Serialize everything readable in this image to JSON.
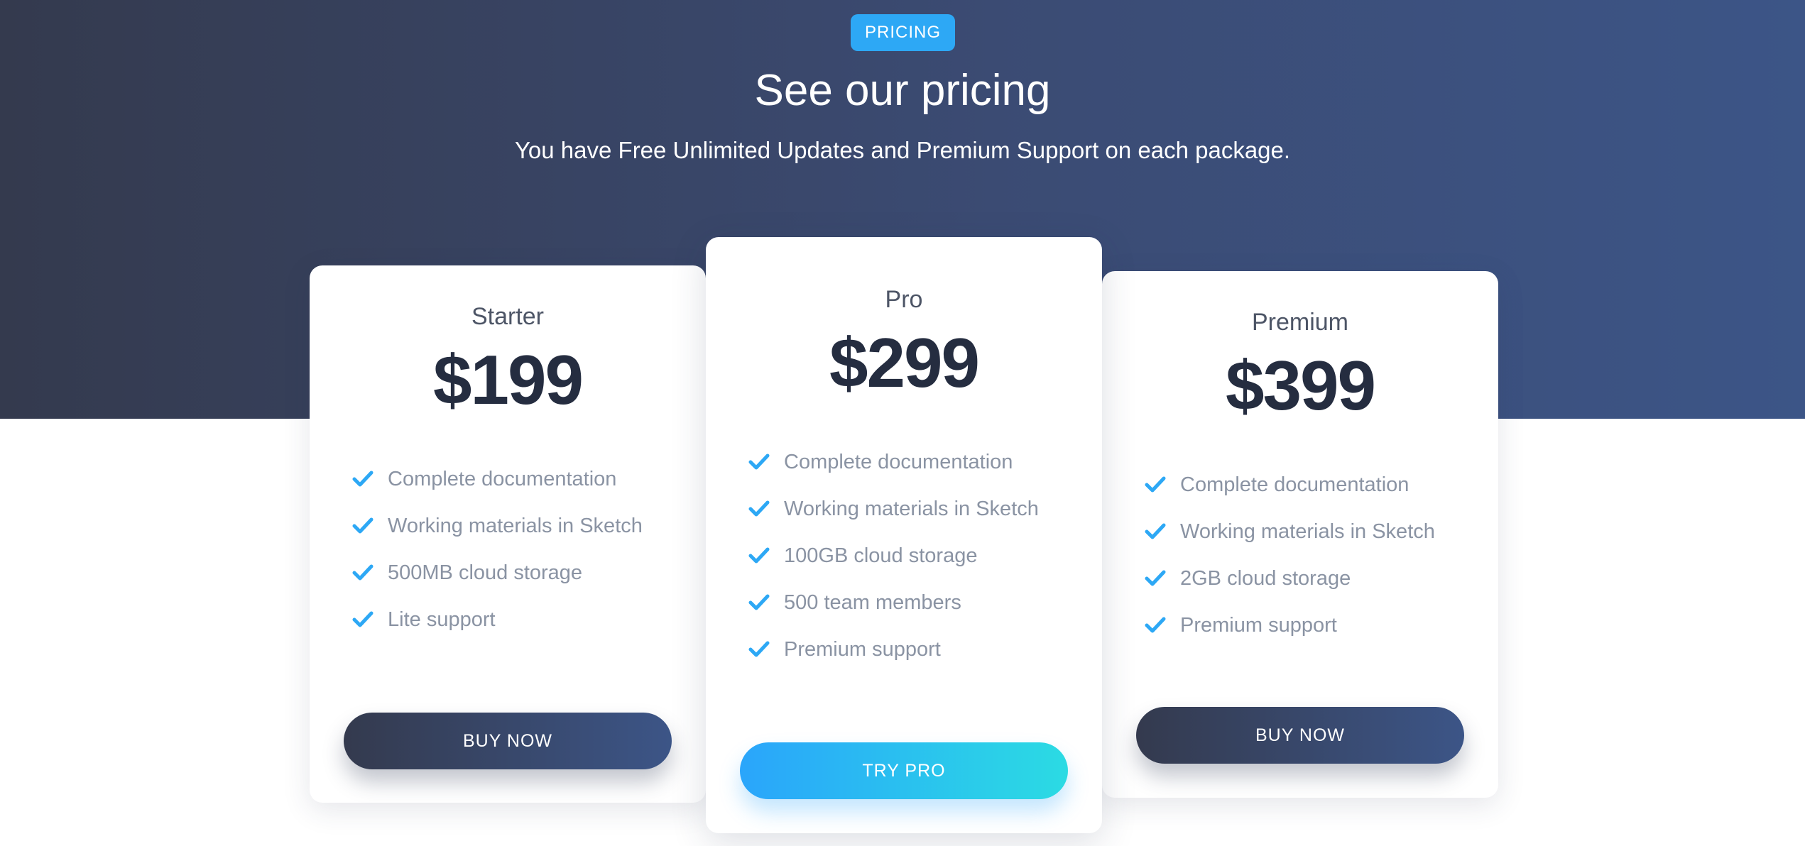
{
  "header": {
    "badge": "PRICING",
    "title": "See our pricing",
    "subtitle": "You have Free Unlimited Updates and Premium Support on each package."
  },
  "plans": [
    {
      "name": "Starter",
      "price": "$199",
      "features": [
        "Complete documentation",
        "Working materials in Sketch",
        "500MB cloud storage",
        "Lite support"
      ],
      "button": "BUY NOW"
    },
    {
      "name": "Pro",
      "price": "$299",
      "features": [
        "Complete documentation",
        "Working materials in Sketch",
        "100GB cloud storage",
        "500 team members",
        "Premium support"
      ],
      "button": "TRY PRO"
    },
    {
      "name": "Premium",
      "price": "$399",
      "features": [
        "Complete documentation",
        "Working materials in Sketch",
        "2GB cloud storage",
        "Premium support"
      ],
      "button": "BUY NOW"
    }
  ],
  "icons": {
    "feature_icon": "check-icon"
  },
  "colors": {
    "hero_start": "#343a4e",
    "hero_end": "#3c5587",
    "accent": "#2da8f5",
    "accent_end": "#2bdbe3",
    "price_text": "#252d40",
    "feature_text": "#8a93a3"
  }
}
